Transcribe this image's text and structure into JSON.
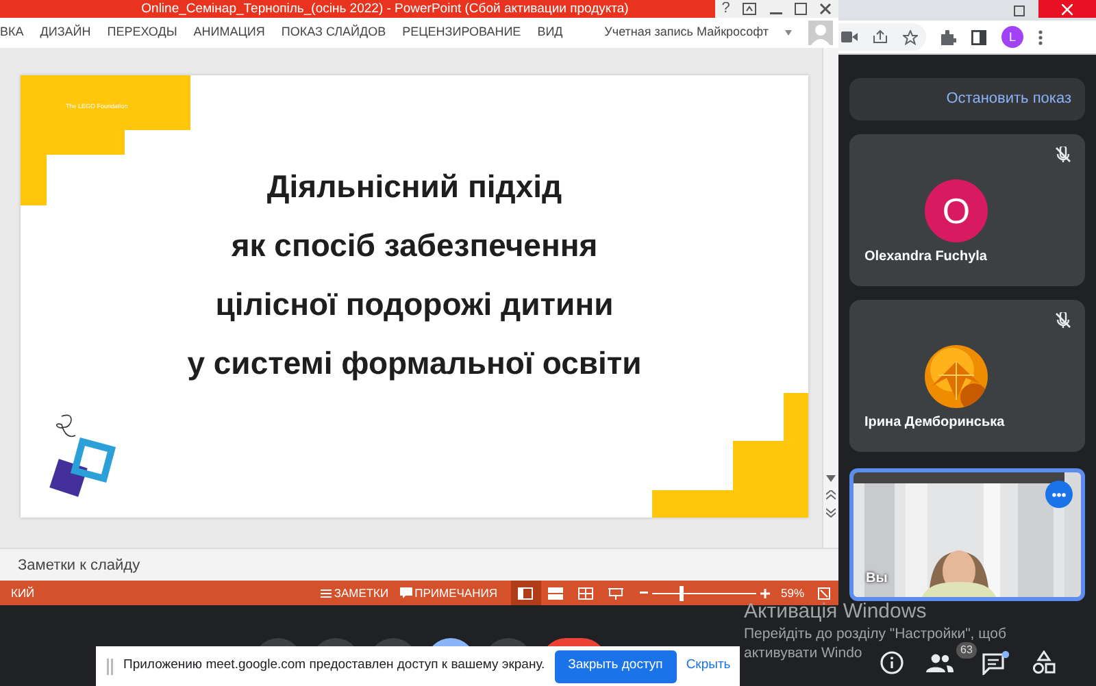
{
  "powerpoint": {
    "title": "Online_Семінар_Тернопіль_(осінь 2022) -  PowerPoint (Сбой активации продукта)",
    "help": "?",
    "ribbon_tabs": [
      "ВКА",
      "ДИЗАЙН",
      "ПЕРЕХОДЫ",
      "АНИМАЦИЯ",
      "ПОКАЗ СЛАЙДОВ",
      "РЕЦЕНЗИРОВАНИЕ",
      "ВИД"
    ],
    "account": "Учетная запись Майкрософт",
    "slide": {
      "logo_text": "The LEGO Foundation",
      "title_lines": [
        "Діяльнісний підхід",
        "як спосіб забезпечення",
        "цілісної подорожі дитини",
        "у системі формальної освіти"
      ]
    },
    "notes": {
      "placeholder": "Заметки к слайду"
    },
    "status_bar": {
      "language": "КИЙ",
      "notes_button": "ЗАМЕТКИ",
      "comments_button": "ПРИМЕЧАНИЯ",
      "views": [
        {
          "kind": "normal",
          "selected": true
        },
        {
          "kind": "sorter",
          "selected": false
        },
        {
          "kind": "reading",
          "selected": false
        },
        {
          "kind": "slideshow",
          "selected": false
        }
      ],
      "zoom": {
        "level": 0.28,
        "reading": "59%"
      }
    }
  },
  "browser": {
    "profile_initial": "L"
  },
  "meet": {
    "stop_button": "Остановить показ",
    "participants": [
      {
        "name": "Olexandra Fuchyla",
        "kind": "initial",
        "initial": "O",
        "muted": true,
        "selected": false
      },
      {
        "name": "Ірина Демборинська",
        "muted": true,
        "selected": false
      },
      {
        "name": "Вы",
        "kind": "video",
        "muted": false,
        "selected": true
      }
    ],
    "participant_count": "63",
    "chat_unread": true,
    "share_notice": {
      "text": "Приложению meet.google.com предоставлен доступ к вашему экрану.",
      "stop_button": "Закрыть доступ",
      "hide_link": "Скрыть"
    }
  },
  "windows_activation": {
    "title": "Активація Windows",
    "lines": [
      "Перейдіть до розділу \"Настройки\", щоб",
      "активувати Windo"
    ]
  }
}
